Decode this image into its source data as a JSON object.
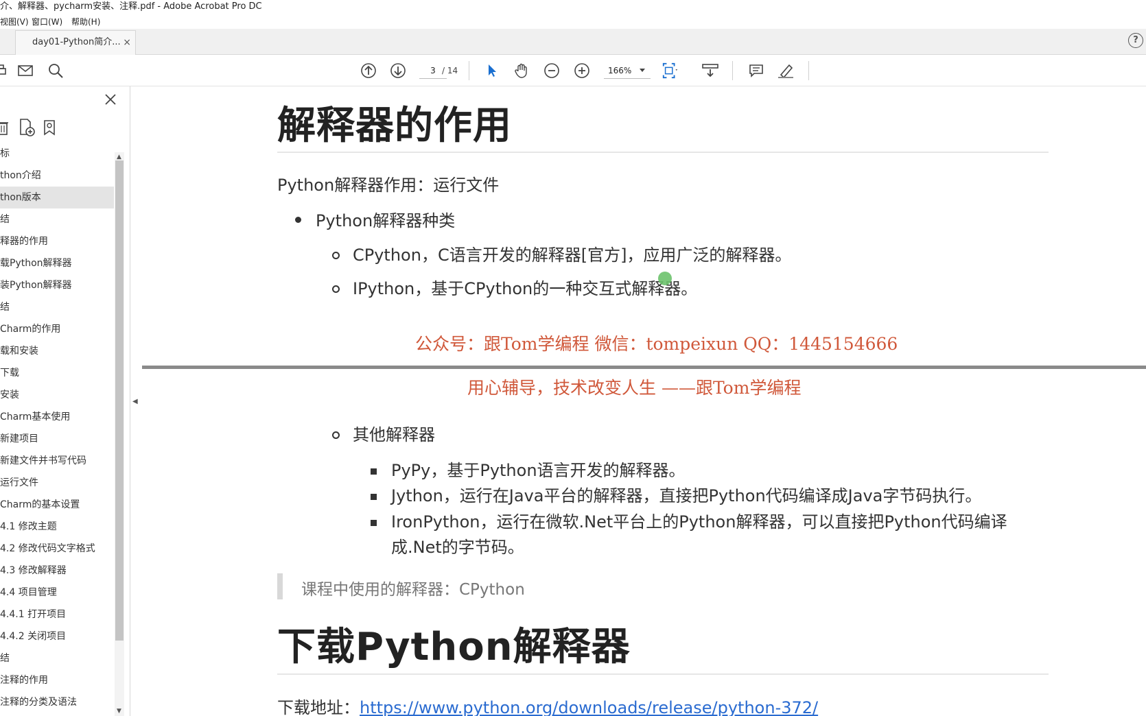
{
  "window": {
    "title": "介、解释器、pycharm安装、注释.pdf - Adobe Acrobat Pro DC"
  },
  "menu": {
    "items": [
      "视图(V)",
      "窗口(W)",
      "帮助(H)"
    ]
  },
  "tab": {
    "label": "day01-Python简介...",
    "close": "×"
  },
  "help": "?",
  "toolbar": {
    "page_current": "3",
    "page_total": "/ 14",
    "zoom": "166%"
  },
  "sidebar": {
    "items": [
      "标",
      "thon介绍",
      "thon版本",
      "结",
      "释器的作用",
      "载Python解释器",
      "装Python解释器",
      "结",
      "Charm的作用",
      "载和安装",
      "下载",
      "安装",
      "Charm基本使用",
      "新建项目",
      "新建文件并书写代码",
      "运行文件",
      "Charm的基本设置",
      "4.1 修改主题",
      "4.2 修改代码文字格式",
      "4.3 修改解释器",
      "4.4 项目管理",
      "4.4.1 打开项目",
      "4.4.2 关闭项目",
      "结",
      "注释的作用",
      "注释的分类及语法"
    ],
    "selected_index": 2
  },
  "doc": {
    "heading1": "解释器的作用",
    "intro": "Python解释器作用：运行文件",
    "bullet1": "Python解释器种类",
    "sub1": "CPython，C语言开发的解释器[官方]，应用广泛的解释器。",
    "sub2": "IPython，基于CPython的一种交互式解释器。",
    "watermark1": "公众号：跟Tom学编程  微信：tompeixun  QQ：1445154666",
    "watermark2": "用心辅导，技术改变人生 ——跟Tom学编程",
    "sub3": "其他解释器",
    "subsub1": "PyPy，基于Python语言开发的解释器。",
    "subsub2": "Jython，运行在Java平台的解释器，直接把Python代码编译成Java字节码执行。",
    "subsub3a": "IronPython，运行在微软.Net平台上的Python解释器，可以直接把Python代码编译",
    "subsub3b": "成.Net的字节码。",
    "quote": "课程中使用的解释器：CPython",
    "heading2": "下载Python解释器",
    "download_label": "下载地址：",
    "download_url": "https://www.python.org/downloads/release/python-372/"
  }
}
